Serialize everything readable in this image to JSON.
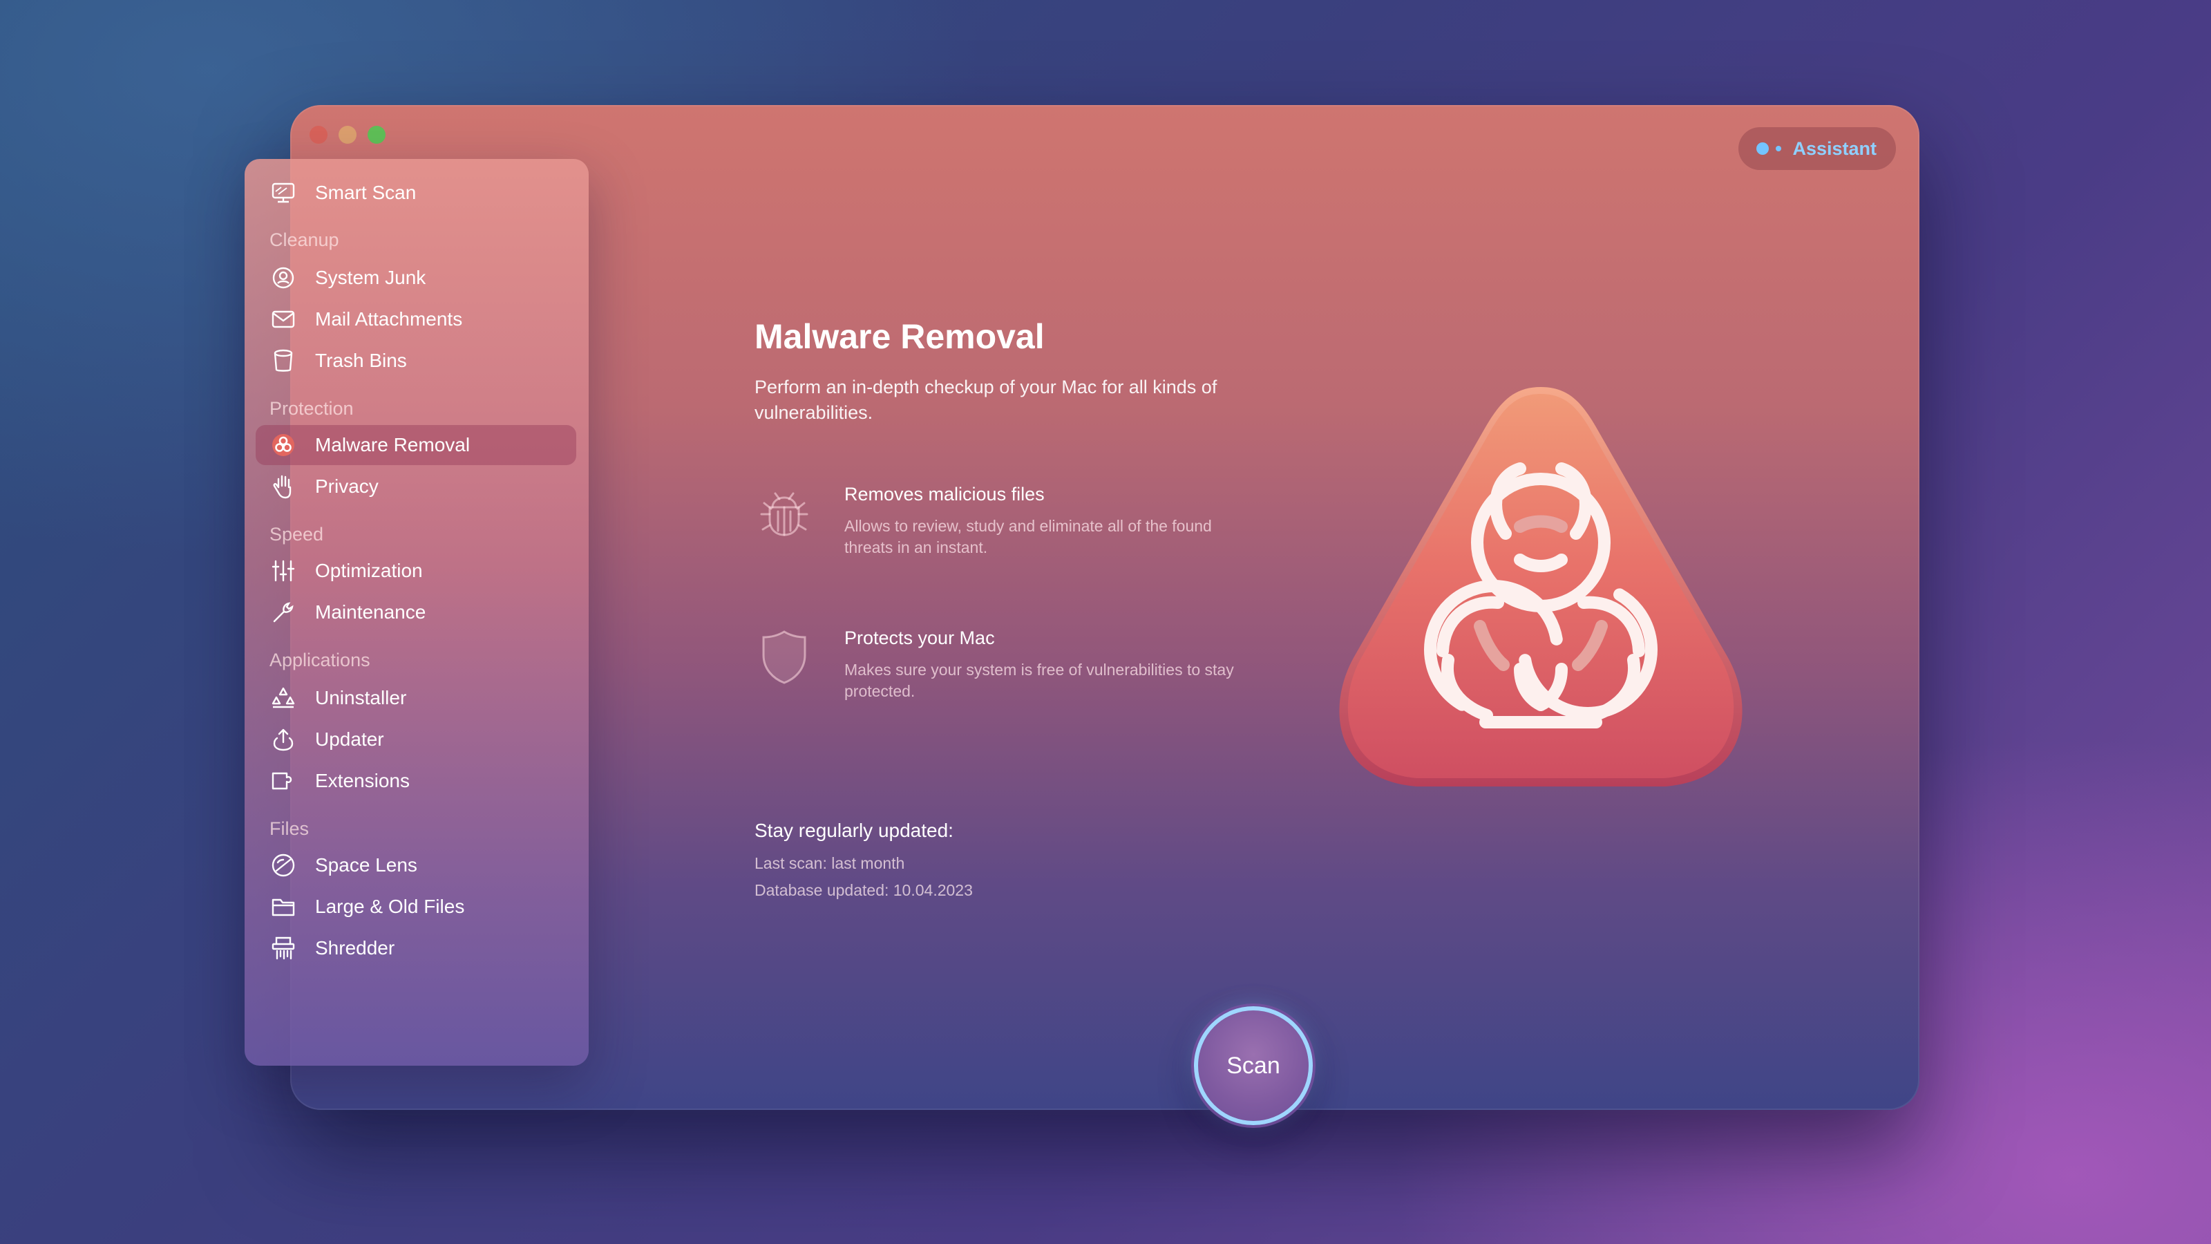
{
  "window": {
    "assistant_label": "Assistant"
  },
  "sidebar": {
    "top_item": {
      "label": "Smart Scan",
      "icon": "monitor-icon"
    },
    "sections": [
      {
        "title": "Cleanup",
        "items": [
          {
            "label": "System Junk",
            "icon": "junk-icon"
          },
          {
            "label": "Mail Attachments",
            "icon": "envelope-icon"
          },
          {
            "label": "Trash Bins",
            "icon": "trash-icon"
          }
        ]
      },
      {
        "title": "Protection",
        "items": [
          {
            "label": "Malware Removal",
            "icon": "biohazard-icon",
            "active": true
          },
          {
            "label": "Privacy",
            "icon": "hand-icon"
          }
        ]
      },
      {
        "title": "Speed",
        "items": [
          {
            "label": "Optimization",
            "icon": "sliders-icon"
          },
          {
            "label": "Maintenance",
            "icon": "wrench-icon"
          }
        ]
      },
      {
        "title": "Applications",
        "items": [
          {
            "label": "Uninstaller",
            "icon": "uninstaller-icon"
          },
          {
            "label": "Updater",
            "icon": "updater-icon"
          },
          {
            "label": "Extensions",
            "icon": "extensions-icon"
          }
        ]
      },
      {
        "title": "Files",
        "items": [
          {
            "label": "Space Lens",
            "icon": "lens-icon"
          },
          {
            "label": "Large & Old Files",
            "icon": "folder-icon"
          },
          {
            "label": "Shredder",
            "icon": "shredder-icon"
          }
        ]
      }
    ]
  },
  "main": {
    "title": "Malware Removal",
    "description": "Perform an in-depth checkup of your Mac for all kinds of vulnerabilities.",
    "features": [
      {
        "title": "Removes malicious files",
        "description": "Allows to review, study and eliminate all of the found threats in an instant.",
        "icon": "bug-icon"
      },
      {
        "title": "Protects your Mac",
        "description": "Makes sure your system is free of vulnerabilities to stay protected.",
        "icon": "shield-icon"
      }
    ],
    "update": {
      "title": "Stay regularly updated:",
      "last_scan": "Last scan: last month",
      "database": "Database updated: 10.04.2023"
    },
    "hero_icon": "biohazard-triangle-icon",
    "scan_label": "Scan"
  },
  "colors": {
    "accent": "#9fd6ff",
    "assistant_text": "#8fd0ff"
  }
}
